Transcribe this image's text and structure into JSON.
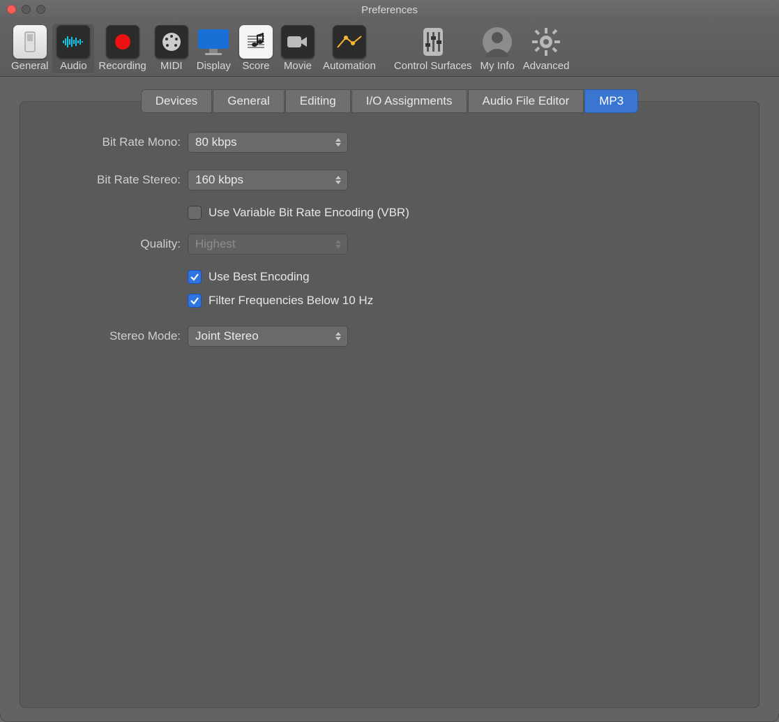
{
  "window": {
    "title": "Preferences"
  },
  "toolbar": {
    "items": [
      {
        "label": "General"
      },
      {
        "label": "Audio"
      },
      {
        "label": "Recording"
      },
      {
        "label": "MIDI"
      },
      {
        "label": "Display"
      },
      {
        "label": "Score"
      },
      {
        "label": "Movie"
      },
      {
        "label": "Automation"
      },
      {
        "label": "Control Surfaces"
      },
      {
        "label": "My Info"
      },
      {
        "label": "Advanced"
      }
    ],
    "selected": "Audio"
  },
  "subtabs": {
    "items": [
      "Devices",
      "General",
      "Editing",
      "I/O Assignments",
      "Audio File Editor",
      "MP3"
    ],
    "active": "MP3"
  },
  "form": {
    "bit_rate_mono": {
      "label": "Bit Rate Mono:",
      "value": "80 kbps"
    },
    "bit_rate_stereo": {
      "label": "Bit Rate Stereo:",
      "value": "160 kbps"
    },
    "vbr": {
      "label": "Use Variable Bit Rate Encoding (VBR)",
      "checked": false
    },
    "quality": {
      "label": "Quality:",
      "value": "Highest",
      "enabled": false
    },
    "best_encoding": {
      "label": "Use Best Encoding",
      "checked": true
    },
    "filter_freq": {
      "label": "Filter Frequencies Below 10 Hz",
      "checked": true
    },
    "stereo_mode": {
      "label": "Stereo Mode:",
      "value": "Joint Stereo"
    }
  }
}
